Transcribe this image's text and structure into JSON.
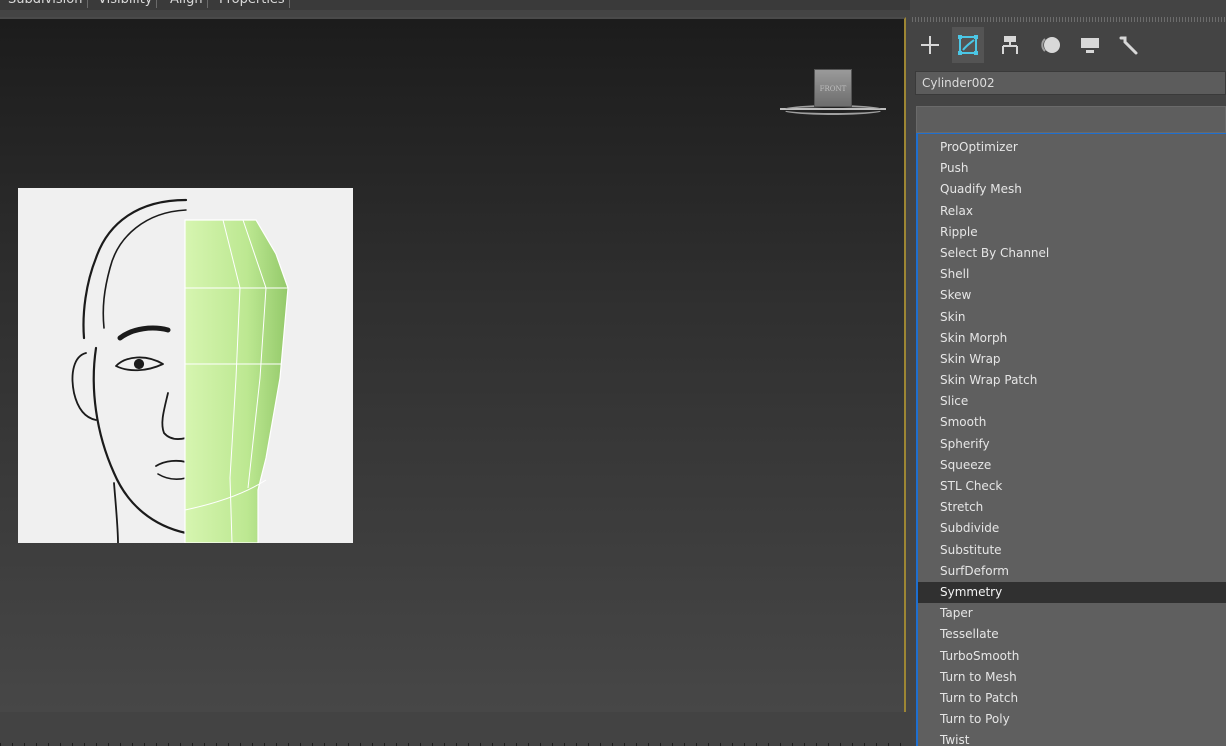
{
  "ribbon": {
    "tabs": [
      "Subdivision",
      "Visibility",
      "Align",
      "Properties"
    ]
  },
  "viewport": {
    "viewcube_face_label": "FRONT"
  },
  "command_panel": {
    "tabs": [
      {
        "name": "create",
        "icon": "plus-icon"
      },
      {
        "name": "modify",
        "icon": "modify-bend-icon",
        "active": true
      },
      {
        "name": "hierarchy",
        "icon": "hierarchy-icon"
      },
      {
        "name": "motion",
        "icon": "motion-icon"
      },
      {
        "name": "display",
        "icon": "display-monitor-icon"
      },
      {
        "name": "utilities",
        "icon": "wrench-icon"
      }
    ],
    "object_name": "Cylinder002",
    "modifier_list": {
      "items": [
        "ProOptimizer",
        "Push",
        "Quadify Mesh",
        "Relax",
        "Ripple",
        "Select By Channel",
        "Shell",
        "Skew",
        "Skin",
        "Skin Morph",
        "Skin Wrap",
        "Skin Wrap Patch",
        "Slice",
        "Smooth",
        "Spherify",
        "Squeeze",
        "STL Check",
        "Stretch",
        "Subdivide",
        "Substitute",
        "SurfDeform",
        "Symmetry",
        "Taper",
        "Tessellate",
        "TurboSmooth",
        "Turn to Mesh",
        "Turn to Patch",
        "Turn to Poly",
        "Twist"
      ],
      "selected": "Symmetry"
    }
  },
  "colors": {
    "viewport_border": "#9d8634",
    "dropdown_border": "#1e6fd0",
    "mesh_green": "#c6ec9e",
    "selected_row": "#303030"
  }
}
